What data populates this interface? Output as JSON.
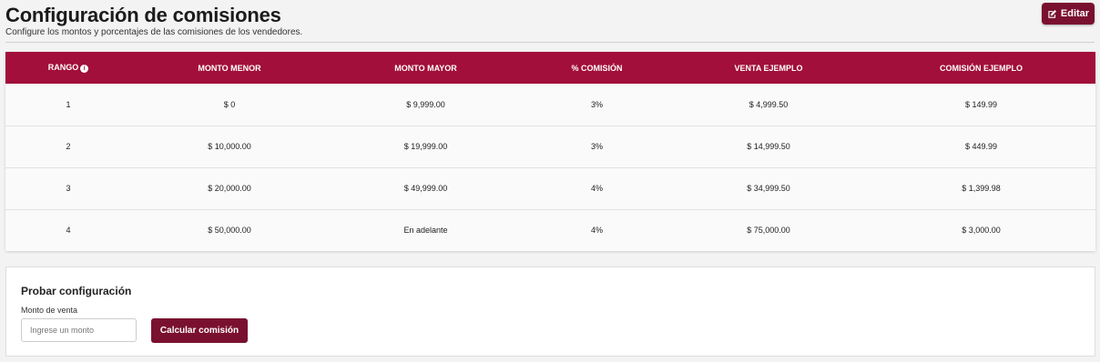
{
  "header": {
    "title": "Configuración de comisiones",
    "subtitle": "Configure los montos y porcentajes de las comisiones de los vendedores.",
    "edit_label": "Editar"
  },
  "table": {
    "columns": [
      "RANGO",
      "MONTO MENOR",
      "MONTO MAYOR",
      "% COMISIÓN",
      "VENTA EJEMPLO",
      "COMISIÓN EJEMPLO"
    ],
    "rows": [
      [
        "1",
        "$ 0",
        "$ 9,999.00",
        "3%",
        "$ 4,999.50",
        "$ 149.99"
      ],
      [
        "2",
        "$ 10,000.00",
        "$ 19,999.00",
        "3%",
        "$ 14,999.50",
        "$ 449.99"
      ],
      [
        "3",
        "$ 20,000.00",
        "$ 49,999.00",
        "4%",
        "$ 34,999.50",
        "$ 1,399.98"
      ],
      [
        "4",
        "$ 50,000.00",
        "En adelante",
        "4%",
        "$ 75,000.00",
        "$ 3,000.00"
      ]
    ]
  },
  "test": {
    "title": "Probar configuración",
    "field_label": "Monto de venta",
    "input_placeholder": "Ingrese un monto",
    "input_value": "",
    "button_label": "Calcular comisión"
  },
  "icons": {
    "edit": "edit-icon",
    "info": "info-icon"
  },
  "colors": {
    "accent": "#a20f3a",
    "button": "#7a1030"
  }
}
